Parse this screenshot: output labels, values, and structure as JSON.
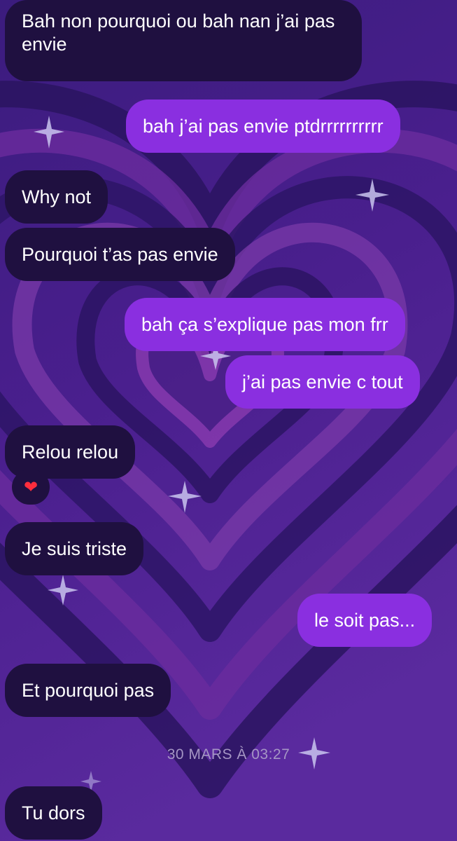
{
  "theme": {
    "them_bubble_color": "#1f1040",
    "me_bubble_color": "#8a2fe0",
    "background": "purple-hearts-sparkles"
  },
  "messages": [
    {
      "sender": "them",
      "text": "Bah non pourquoi ou bah nan j’ai pas envie"
    },
    {
      "sender": "me",
      "text": "bah j’ai pas envie ptdrrrrrrrrrr"
    },
    {
      "sender": "them",
      "text": "Why not"
    },
    {
      "sender": "them",
      "text": "Pourquoi t’as pas envie"
    },
    {
      "sender": "me",
      "text": "bah ça s’explique pas mon frr"
    },
    {
      "sender": "me",
      "text": "j’ai pas envie c tout"
    },
    {
      "sender": "them",
      "text": "Relou relou",
      "reaction": "heart-icon"
    },
    {
      "sender": "them",
      "text": "Je suis triste"
    },
    {
      "sender": "me",
      "text": "le soit pas..."
    },
    {
      "sender": "them",
      "text": "Et pourquoi pas"
    },
    {
      "sender": "them",
      "text": "Tu dors"
    }
  ],
  "timestamp": "30 MARS À 03:27",
  "reaction_glyph": "❤"
}
